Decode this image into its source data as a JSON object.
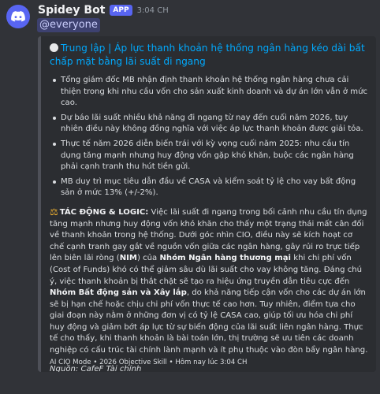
{
  "message": {
    "bot_name": "Spidey Bot",
    "badge": "APP",
    "time": "3:04 CH",
    "mention": "@everyone"
  },
  "embed": {
    "title": "Trung lập | Áp lực thanh khoản hệ thống ngân hàng kéo dài bất chấp mặt bằng lãi suất đi ngang",
    "bullets": [
      "Tổng giám đốc MB nhận định thanh khoản hệ thống ngân hàng chưa cải thiện trong khi nhu cầu vốn cho sản xuất kinh doanh và dự án lớn vẫn ở mức cao.",
      "Dự báo lãi suất nhiều khả năng đi ngang từ nay đến cuối năm 2026, tuy nhiên điều này không đồng nghĩa với việc áp lực thanh khoản được giải tỏa.",
      "Thực tế năm 2026 diễn biến trái với kỳ vọng cuối năm 2025: nhu cầu tín dụng tăng mạnh nhưng huy động vốn gặp khó khăn, buộc các ngân hàng phải cạnh tranh thu hút tiền gửi.",
      "MB duy trì mục tiêu dẫn đầu về CASA và kiểm soát tỷ lệ cho vay bất động sản ở mức 13% (+/-2%)."
    ],
    "impact": {
      "label": "TÁC ĐỘNG & LOGIC:",
      "text_1": " Việc lãi suất đi ngang trong bối cảnh nhu cầu tín dụng tăng mạnh nhưng huy động vốn khó khăn cho thấy một trạng thái mất cân đối về thanh khoản trong hệ thống. Dưới góc nhìn CIO, điều này sẽ kích hoạt cơ chế cạnh tranh gay gắt về nguồn vốn giữa các ngân hàng, gây rủi ro trực tiếp lên biên lãi ròng (",
      "nim": "NIM",
      "text_2": ") của ",
      "bank_group": "Nhóm Ngân hàng thương mại",
      "text_3": " khi chi phí vốn (Cost of Funds) khó có thể giảm sâu dù lãi suất cho vay không tăng. Đáng chú ý, việc thanh khoản bị thắt chặt sẽ tạo ra hiệu ứng truyền dẫn tiêu cực đến ",
      "realestate_group": "Nhóm Bất động sản và Xây lắp",
      "text_4": ", do khả năng tiếp cận vốn cho các dự án lớn sẽ bị hạn chế hoặc chịu chi phí vốn thực tế cao hơn. Tuy nhiên, điểm tựa cho giai đoạn này nằm ở những đơn vị có tỷ lệ CASA cao, giúp tối ưu hóa chi phí huy động và giảm bớt áp lực từ sự biến động của lãi suất liên ngân hàng. Thực tế cho thấy, khi thanh khoản là bài toán lớn, thị trường sẽ ưu tiên các doanh nghiệp có cấu trúc tài chính lành mạnh và ít phụ thuộc vào đòn bẩy ngân hàng."
    },
    "source": "Nguồn: CafeF Tài chính",
    "footer": "AI CIO Mode • 2026 Objective Skill • Hôm nay lúc 3:04 CH"
  }
}
